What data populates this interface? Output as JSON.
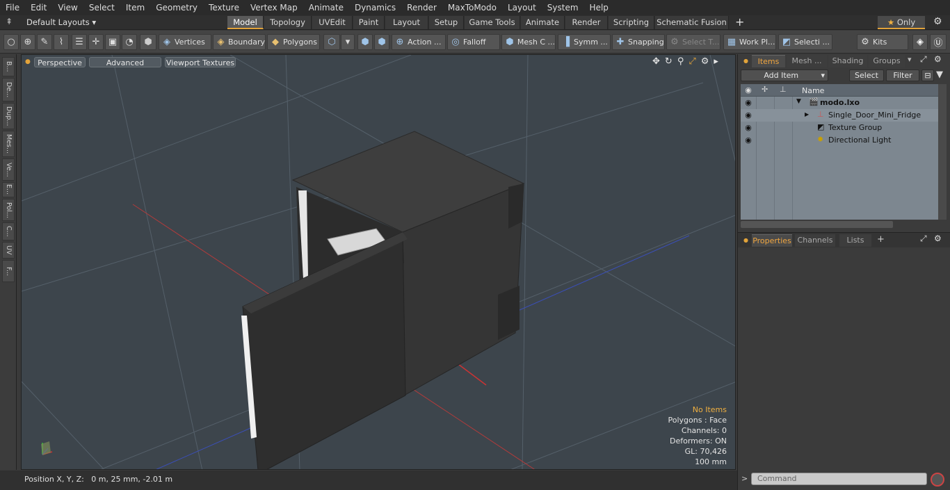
{
  "menu": [
    "File",
    "Edit",
    "View",
    "Select",
    "Item",
    "Geometry",
    "Texture",
    "Vertex Map",
    "Animate",
    "Dynamics",
    "Render",
    "MaxToModo",
    "Layout",
    "System",
    "Help"
  ],
  "layouts_dropdown": "Default Layouts",
  "layout_tabs": [
    "Model",
    "Topology",
    "UVEdit",
    "Paint",
    "Layout",
    "Setup",
    "Game Tools",
    "Animate",
    "Render",
    "Scripting",
    "Schematic Fusion"
  ],
  "active_layout": "Model",
  "only_label": "Only",
  "toolbar": {
    "vertices": "Vertices",
    "boundary": "Boundary",
    "polygons": "Polygons",
    "action": "Action ...",
    "falloff": "Falloff",
    "mesh_c": "Mesh C ...",
    "symm": "Symm ...",
    "snapping": "Snapping",
    "select_t": "Select T...",
    "work_pl": "Work Pl...",
    "selecti": "Selecti ...",
    "kits": "Kits"
  },
  "left_tabs": [
    "B...",
    "De...",
    "Dup...",
    "Mes...",
    "Ve...",
    "E...",
    "Pol...",
    "C...",
    "UV",
    "F..."
  ],
  "viewport": {
    "perspective": "Perspective",
    "advanced": "Advanced",
    "viewport_textures": "Viewport Textures",
    "info": {
      "no_items": "No Items",
      "polygons": "Polygons : Face",
      "channels": "Channels: 0",
      "deformers": "Deformers: ON",
      "gl": "GL: 70,426",
      "scale": "100 mm"
    }
  },
  "status": {
    "position": "Position X, Y, Z:   0 m, 25 mm, -2.01 m"
  },
  "items_panel": {
    "tabs": [
      "Items",
      "Mesh ...",
      "Shading",
      "Groups"
    ],
    "active": "Items",
    "add_item": "Add Item",
    "select": "Select",
    "filter": "Filter",
    "name_header": "Name",
    "tree": [
      {
        "label": "modo.lxo"
      },
      {
        "label": "Single_Door_Mini_Fridge"
      },
      {
        "label": "Texture Group"
      },
      {
        "label": "Directional Light"
      }
    ]
  },
  "props_panel": {
    "tabs": [
      "Properties",
      "Channels",
      "Lists"
    ],
    "active": "Properties"
  },
  "command_placeholder": "Command",
  "colors": {
    "accent": "#e2a33a",
    "viewport_bg": "#3d454c",
    "list_bg": "#7d8790"
  }
}
